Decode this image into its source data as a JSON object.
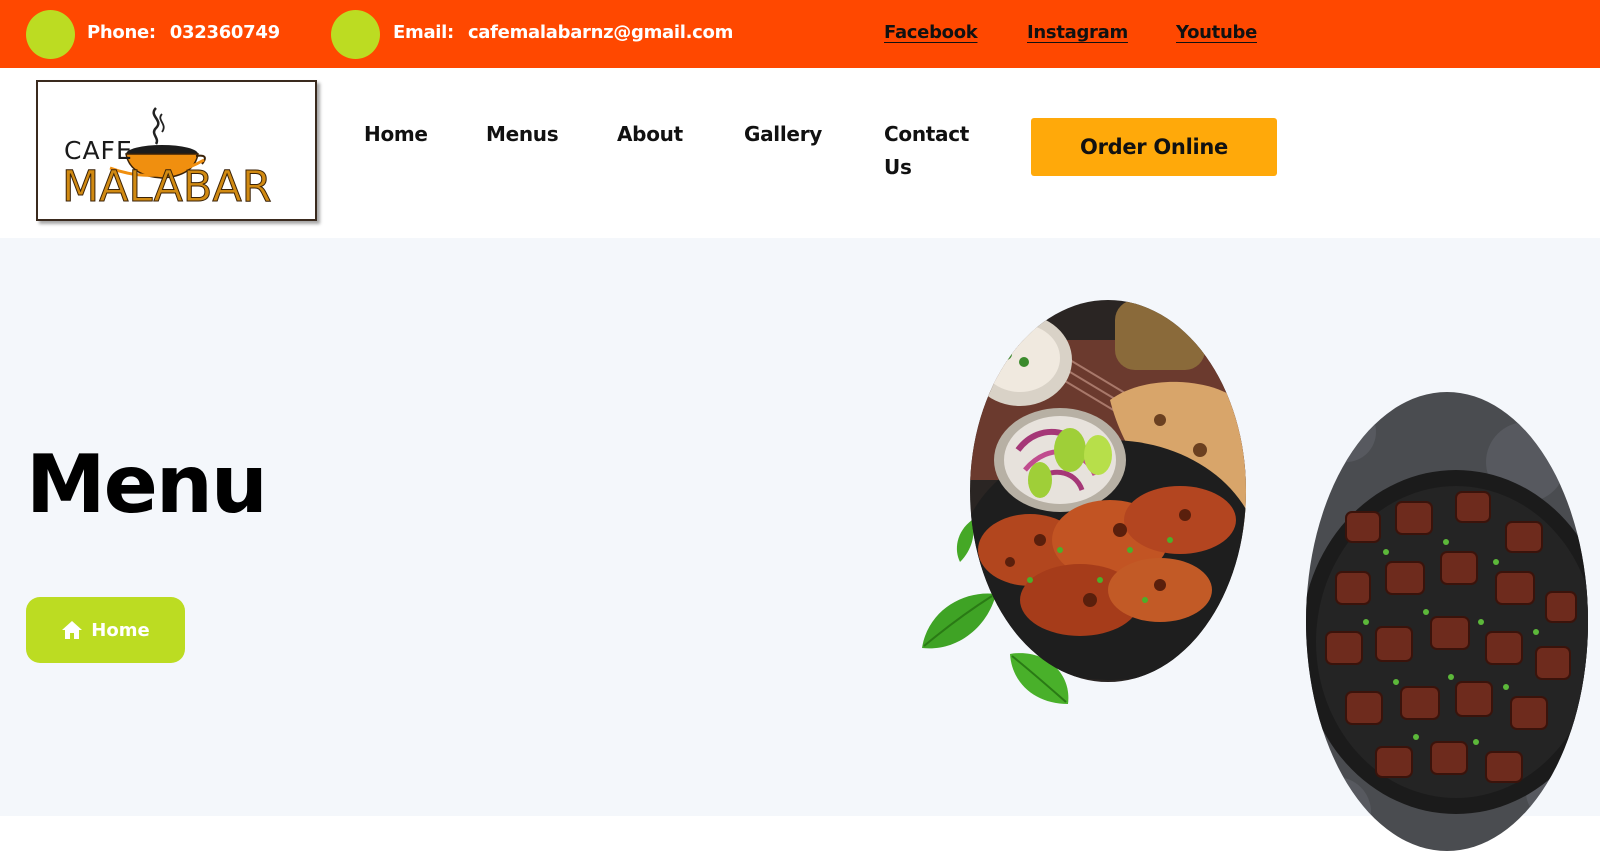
{
  "topbar": {
    "phone_label": "Phone:",
    "phone_value": "032360749",
    "email_label": "Email:",
    "email_value": "cafemalabarnz@gmail.com",
    "social": [
      "Facebook",
      "Instagram",
      "Youtube"
    ]
  },
  "logo": {
    "line1": "CAFE",
    "line2": "MALABAR"
  },
  "nav": {
    "items": [
      "Home",
      "Menus",
      "About",
      "Gallery",
      "Contact Us"
    ],
    "order_button": "Order Online"
  },
  "hero": {
    "title": "Menu",
    "breadcrumb_home": "Home"
  },
  "colors": {
    "topbar_bg": "#ff4800",
    "accent_green": "#bcdc22",
    "order_button_bg": "#ffa90a",
    "hero_bg": "#f4f7fb"
  },
  "icons": {
    "phone": "phone-icon-circle",
    "email": "email-icon-circle",
    "home": "home-icon"
  }
}
